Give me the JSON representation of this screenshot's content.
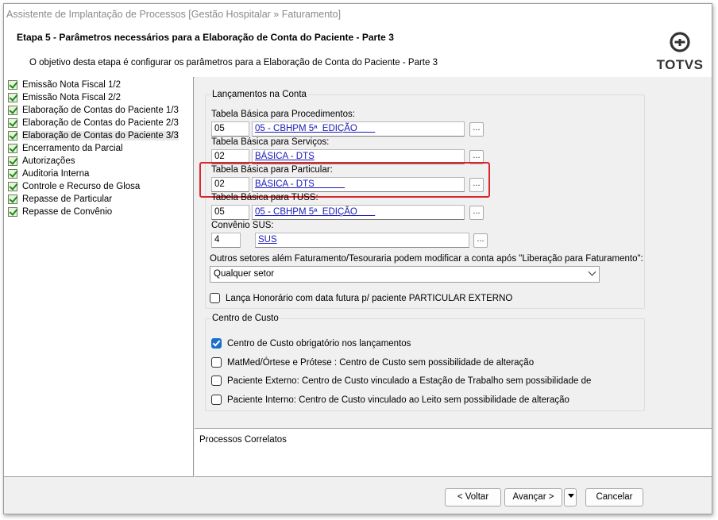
{
  "window": {
    "title": "Assistente de Implantação de Processos [Gestão Hospitalar » Faturamento]"
  },
  "header": {
    "step_title": "Etapa 5 - Parâmetros necessários para a Elaboração de Conta do Paciente - Parte 3",
    "description": "O objetivo desta etapa é configurar os parâmetros para a Elaboração de Conta do Paciente - Parte 3",
    "logo_text": "TOTVS"
  },
  "sidebar": {
    "items": [
      {
        "label": "Emissão Nota Fiscal 1/2"
      },
      {
        "label": "Emissão Nota Fiscal 2/2"
      },
      {
        "label": "Elaboração de Contas do Paciente 1/3"
      },
      {
        "label": "Elaboração de Contas do Paciente 2/3"
      },
      {
        "label": "Elaboração de Contas do Paciente 3/3"
      },
      {
        "label": "Encerramento da Parcial"
      },
      {
        "label": "Autorizações"
      },
      {
        "label": "Auditoria Interna"
      },
      {
        "label": "Controle e Recurso de Glosa"
      },
      {
        "label": "Repasse de Particular"
      },
      {
        "label": "Repasse de Convênio"
      }
    ]
  },
  "lancamentos": {
    "title": "Lançamentos na Conta",
    "fields": [
      {
        "label": "Tabela Básica para Procedimentos:",
        "code": "05",
        "description": "05 - CBHPM 5ª  EDIÇÃO       "
      },
      {
        "label": "Tabela Básica para Serviços:",
        "code": "02",
        "description": "BÁSICA - DTS"
      },
      {
        "label": "Tabela Básica para Particular:",
        "code": "02",
        "description": "BÁSICA - DTS            "
      },
      {
        "label": "Tabela Básica para TUSS:",
        "code": "05",
        "description": "05 - CBHPM 5ª  EDIÇÃO       "
      },
      {
        "label": "Convênio SUS:",
        "code": "4",
        "description": "SUS"
      }
    ],
    "lookup_button": "...",
    "outros_label": "Outros setores além Faturamento/Tesouraria podem modificar a conta após \"Liberação para Faturamento\":",
    "outros_value": "Qualquer setor",
    "honorario_label": "Lança Honorário com data futura p/ paciente PARTICULAR EXTERNO",
    "honorario_checked": false
  },
  "centro_custo": {
    "title": "Centro de Custo",
    "options": [
      {
        "label": "Centro de Custo obrigatório nos lançamentos",
        "checked": true
      },
      {
        "label": "MatMed/Órtese e Prótese : Centro de Custo sem possibilidade de alteração",
        "checked": false
      },
      {
        "label": "Paciente Externo: Centro de Custo vinculado a Estação de Trabalho sem possibilidade de",
        "checked": false
      },
      {
        "label": "Paciente Interno: Centro de Custo vinculado ao Leito sem possibilidade de alteração",
        "checked": false
      }
    ]
  },
  "related": {
    "title": "Processos Correlatos"
  },
  "footer": {
    "back": "< Voltar",
    "next": "Avançar >",
    "cancel": "Cancelar"
  },
  "colors": {
    "highlight": "#d9272e",
    "link": "#1a1ab8",
    "checkbox_checked": "#1a6fcc"
  }
}
